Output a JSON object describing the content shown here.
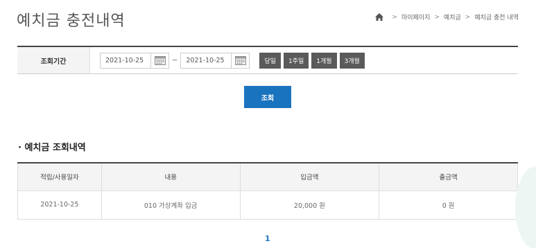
{
  "page": {
    "title": "예치금 충전내역"
  },
  "breadcrumb": {
    "items": [
      "마이페이지",
      "예치금",
      "예치금 충전 내역"
    ],
    "separator": ">"
  },
  "filter": {
    "label": "조회기간",
    "start_date": "2021-10-25",
    "end_date": "2021-10-25",
    "range_separator": "~",
    "quick_buttons": [
      "당일",
      "1주일",
      "1개월",
      "3개월"
    ]
  },
  "search": {
    "label": "조회"
  },
  "section": {
    "title": "· 예치금 조회내역"
  },
  "table": {
    "headers": [
      "적립/사용일자",
      "내용",
      "입금액",
      "출금액"
    ],
    "rows": [
      [
        "2021-10-25",
        "010 가상계좌 입금",
        "20,000 원",
        "0 원"
      ]
    ]
  },
  "pagination": {
    "current_page": "1"
  },
  "colors": {
    "accent": "#1a73bf",
    "quick_button_bg": "#5a5a5a"
  }
}
